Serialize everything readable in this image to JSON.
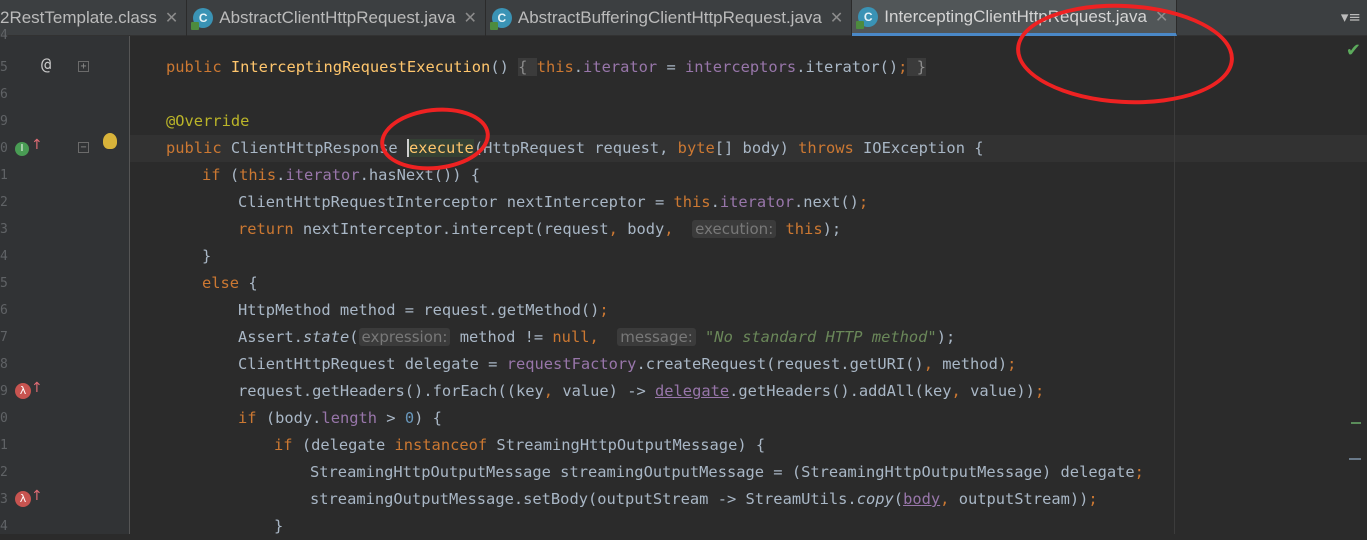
{
  "tabs": [
    {
      "label": "2RestTemplate.class",
      "active": false,
      "icon": "class-file-icon"
    },
    {
      "label": "AbstractClientHttpRequest.java",
      "active": false,
      "icon": "java-class-icon"
    },
    {
      "label": "AbstractBufferingClientHttpRequest.java",
      "active": false,
      "icon": "java-class-icon"
    },
    {
      "label": "InterceptingClientHttpRequest.java",
      "active": true,
      "icon": "java-class-icon"
    }
  ],
  "tab_menu_label": "▾≡",
  "gutter": {
    "line_numbers": [
      "4",
      "5",
      "6",
      "9",
      "0",
      "1",
      "2",
      "3",
      "4",
      "5",
      "6",
      "7",
      "8",
      "9",
      "0",
      "1",
      "2",
      "3",
      "4"
    ],
    "at_symbol": "@",
    "fold_plus": "+",
    "fold_minus": "−",
    "impl_mark": "I",
    "lambda_mark": "λ",
    "up_arrow": "↑"
  },
  "code": {
    "l5_kw": "public ",
    "l5_fn": "InterceptingRequestExecution",
    "l5_paren": "() ",
    "l5_fold_open": "{ ",
    "l5_this": "this",
    "l5_dot": ".",
    "l5_field": "iterator",
    "l5_eq": " = ",
    "l5_interceptors": "interceptors",
    "l5_call": ".iterator()",
    "l5_semi": ";",
    "l5_fold_close": " }",
    "l9_ann": "@Override",
    "l10_kw": "public ",
    "l10_type": "ClientHttpResponse ",
    "l10_fn": "execute",
    "l10_params_a": "(HttpRequest request, ",
    "l10_byte": "byte",
    "l10_params_b": "[] body) ",
    "l10_throws": "throws ",
    "l10_exc": "IOException {",
    "l11_if": "if ",
    "l11_open": "(",
    "l11_this": "this",
    "l11_dot": ".",
    "l11_field": "iterator",
    "l11_rest": ".hasNext()) {",
    "l12_a": "ClientHttpRequestInterceptor nextInterceptor = ",
    "l12_this": "this",
    "l12_dot": ".",
    "l12_field": "iterator",
    "l12_rest": ".next()",
    "l12_semi": ";",
    "l13_return": "return ",
    "l13_a": "nextInterceptor.intercept(request",
    "l13_comma1": ", ",
    "l13_body": "body",
    "l13_comma2": ",  ",
    "l13_hint": "execution:",
    "l13_this": " this",
    "l13_end": ");",
    "l14_brace": "}",
    "l15_else": "else ",
    "l15_brace": "{",
    "l16_a": "HttpMethod method = request.getMethod()",
    "l16_semi": ";",
    "l17_a": "Assert.",
    "l17_state": "state",
    "l17_open": "(",
    "l17_hint1": "expression:",
    "l17_b": " method != ",
    "l17_null": "null",
    "l17_comma": ",  ",
    "l17_hint2": "message:",
    "l17_str": " \"No standard HTTP method\"",
    "l17_end": ");",
    "l18_a": "ClientHttpRequest delegate = ",
    "l18_field": "requestFactory",
    "l18_b": ".createRequest(request.getURI()",
    "l18_comma": ", ",
    "l18_c": "method)",
    "l18_semi": ";",
    "l19_a": "request.getHeaders().forEach((key",
    "l19_comma1": ", ",
    "l19_b": "value) -> ",
    "l19_delegate": "delegate",
    "l19_c": ".getHeaders().addAll(key",
    "l19_comma2": ", ",
    "l19_d": "value))",
    "l19_semi": ";",
    "l20_if": "if ",
    "l20_a": "(body.",
    "l20_len": "length",
    "l20_b": " > ",
    "l20_zero": "0",
    "l20_c": ") {",
    "l21_if": "if ",
    "l21_a": "(delegate ",
    "l21_inst": "instanceof ",
    "l21_b": "StreamingHttpOutputMessage) {",
    "l22_a": "StreamingHttpOutputMessage streamingOutputMessage = (StreamingHttpOutputMessage) delegate",
    "l22_semi": ";",
    "l23_a": "streamingOutputMessage.setBody(outputStream -> StreamUtils.",
    "l23_copy": "copy",
    "l23_open": "(",
    "l23_body": "body",
    "l23_comma": ", ",
    "l23_b": "outputStream))",
    "l23_semi": ";",
    "l24_brace": "}"
  },
  "colors": {
    "editor_bg": "#2b2b2b",
    "gutter_bg": "#313335",
    "keyword": "#cc7832",
    "method_decl": "#ffc66d",
    "field": "#9876aa",
    "annotation": "#bbb529",
    "string": "#6a8759",
    "number": "#6897bb",
    "default_text": "#a9b7c6",
    "annotation_circle": "#ee2222"
  }
}
